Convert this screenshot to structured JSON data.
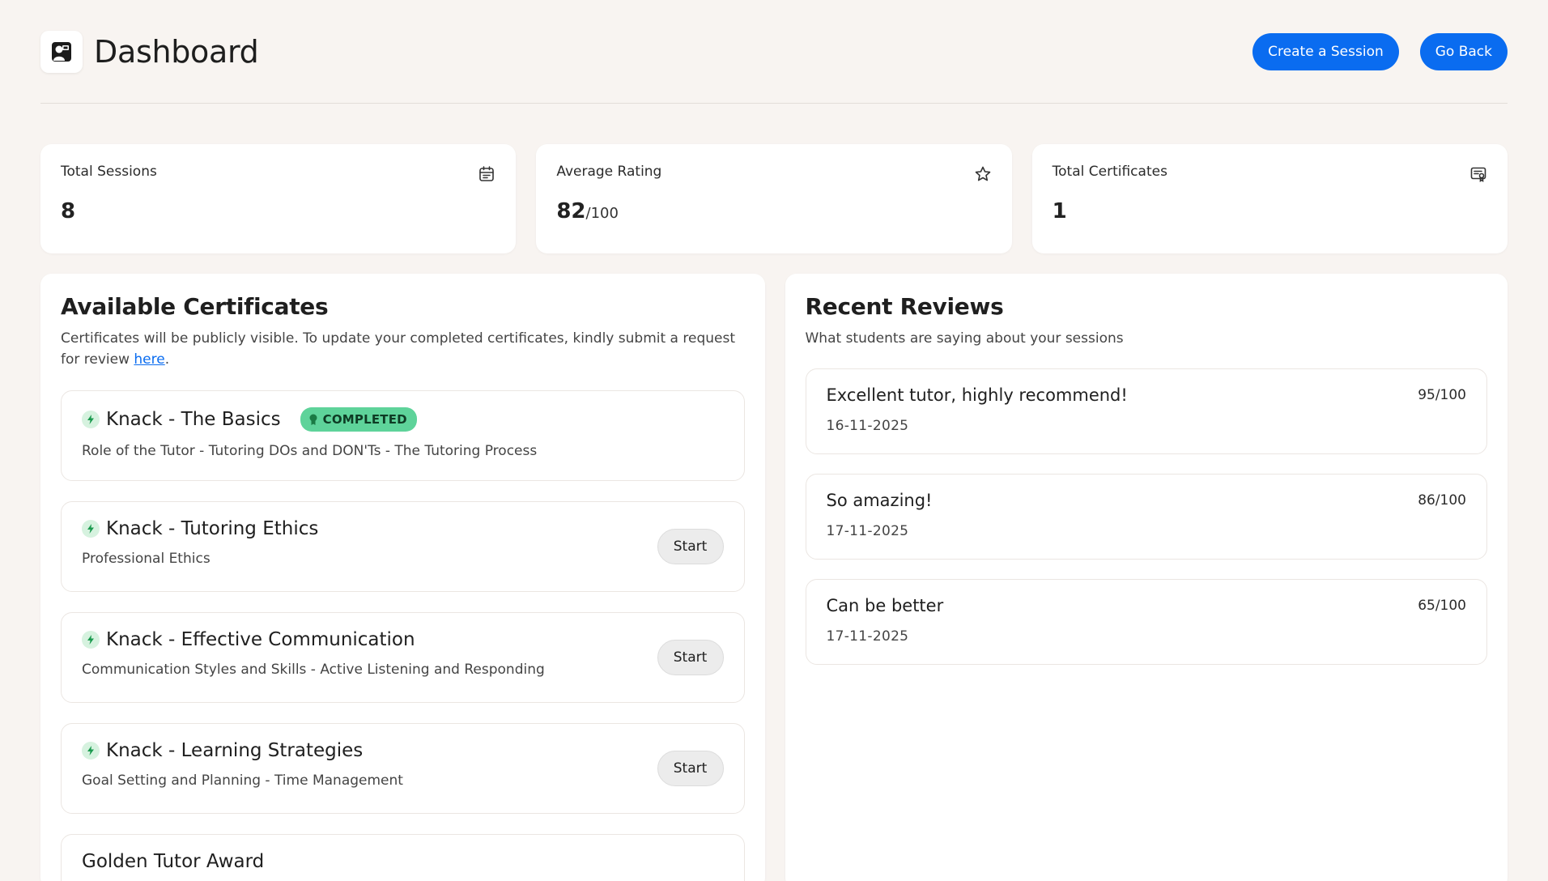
{
  "header": {
    "title": "Dashboard",
    "create_label": "Create a Session",
    "back_label": "Go Back"
  },
  "stats": [
    {
      "label": "Total Sessions",
      "value": "8",
      "suffix": "",
      "icon": "calendar-icon"
    },
    {
      "label": "Average Rating",
      "value": "82",
      "suffix": "/100",
      "icon": "star-icon"
    },
    {
      "label": "Total Certificates",
      "value": "1",
      "suffix": "",
      "icon": "certificate-icon"
    }
  ],
  "certificates": {
    "title": "Available Certificates",
    "desc": "Certificates will be publicly visible. To update your completed certificates, kindly submit a request for review ",
    "link": "here",
    "desc_end": ".",
    "items": [
      {
        "title": "Knack - The Basics",
        "subtitle": "Role of the Tutor - Tutoring DOs and DON'Ts - The Tutoring Process",
        "badge": "COMPLETED"
      },
      {
        "title": "Knack - Tutoring Ethics",
        "subtitle": "Professional Ethics",
        "button": "Start"
      },
      {
        "title": "Knack - Effective Communication",
        "subtitle": "Communication Styles and Skills - Active Listening and Responding",
        "button": "Start"
      },
      {
        "title": "Knack - Learning Strategies",
        "subtitle": "Goal Setting and Planning - Time Management",
        "button": "Start"
      },
      {
        "title": "Golden Tutor Award"
      }
    ]
  },
  "reviews": {
    "title": "Recent Reviews",
    "desc": "What students are saying about your sessions",
    "items": [
      {
        "text": "Excellent tutor, highly recommend!",
        "score": "95/100",
        "date": "16-11-2025"
      },
      {
        "text": "So amazing!",
        "score": "86/100",
        "date": "17-11-2025"
      },
      {
        "text": "Can be better",
        "score": "65/100",
        "date": "17-11-2025"
      }
    ]
  },
  "colors": {
    "primary": "#0a6cf0",
    "background": "#f8f4f1",
    "badge": "#5ed39a"
  }
}
